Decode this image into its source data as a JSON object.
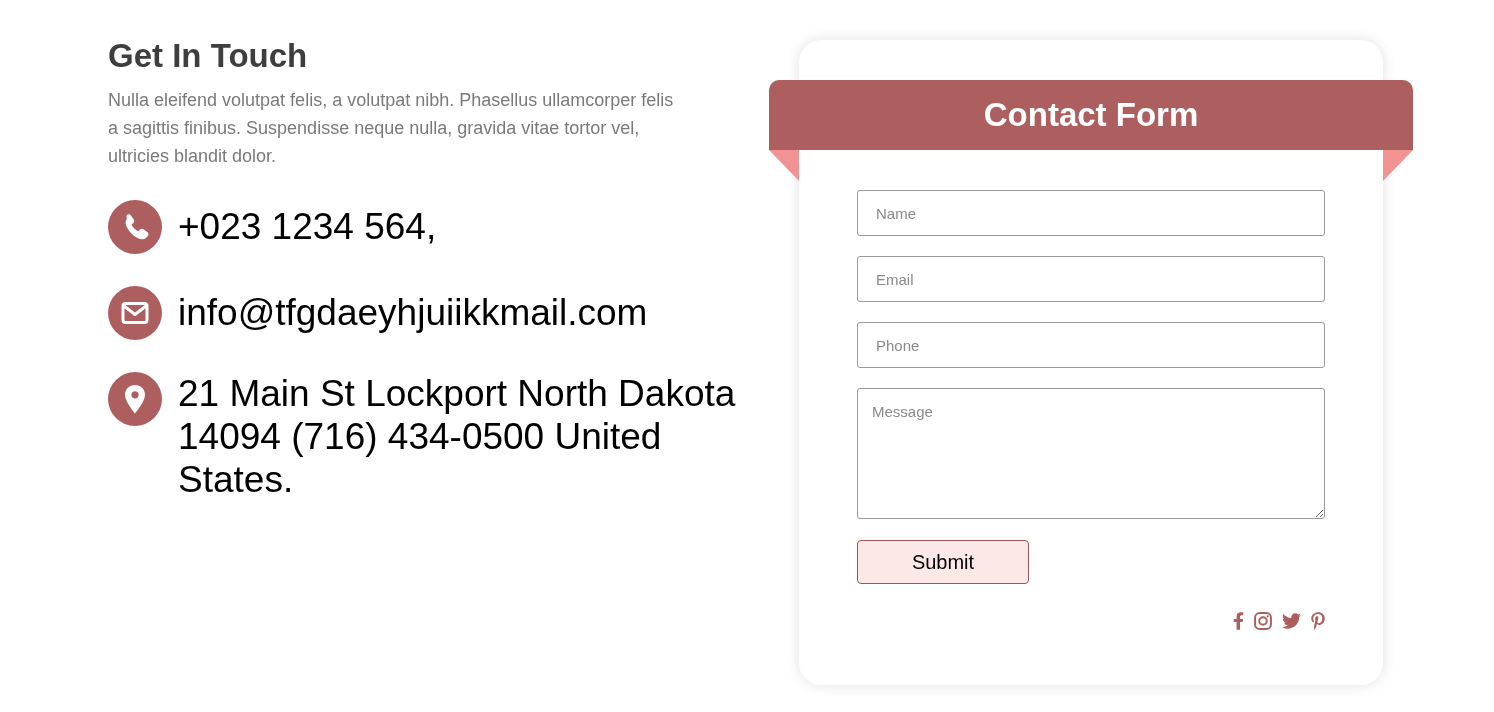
{
  "intro": {
    "title": "Get In Touch",
    "text": "Nulla eleifend volutpat felis, a volutpat nibh. Phasellus ullamcorper felis a sagittis finibus. Suspendisse neque nulla, gravida vitae tortor vel, ultricies blandit dolor."
  },
  "contacts": [
    {
      "kind": "phone",
      "text": "+023 1234 564,"
    },
    {
      "kind": "email",
      "text": "info@tfgdaeyhjuiikkmail.com"
    },
    {
      "kind": "address",
      "text": "21 Main St Lockport North Dakota 14094 (716) 434-0500 United States."
    }
  ],
  "form": {
    "title": "Contact Form",
    "fields": [
      {
        "kind": "input",
        "placeholder": "Name"
      },
      {
        "kind": "input",
        "placeholder": "Email"
      },
      {
        "kind": "input",
        "placeholder": "Phone"
      },
      {
        "kind": "textarea",
        "placeholder": "Message"
      }
    ],
    "submit": "Submit"
  }
}
